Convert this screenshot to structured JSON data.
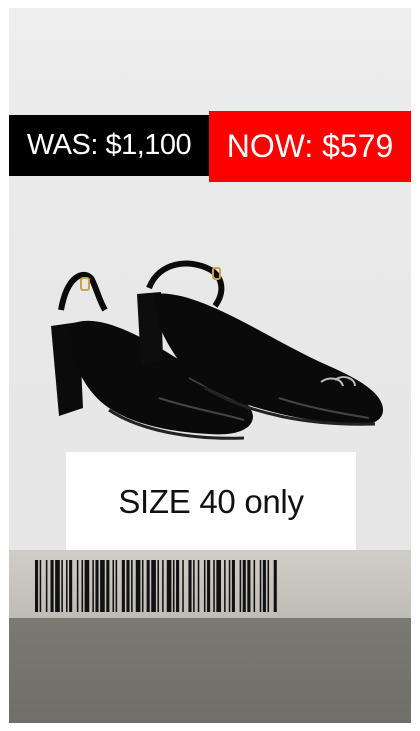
{
  "price": {
    "was_label": "WAS: $1,100",
    "now_label": "NOW: $579"
  },
  "product": {
    "image_name": "black-patent-slingback-heels"
  },
  "size": {
    "label": "SIZE 40 only"
  },
  "colors": {
    "now_background": "#ff0000",
    "was_background": "#000000"
  }
}
